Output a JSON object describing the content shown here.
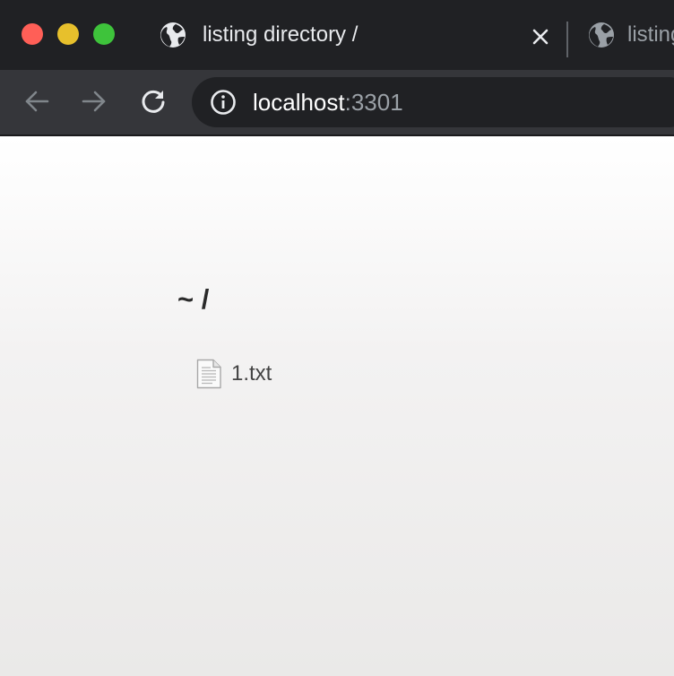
{
  "window": {
    "controls": [
      "close",
      "minimize",
      "maximize"
    ]
  },
  "tabs": [
    {
      "title": "listing directory /",
      "active": true,
      "icon": "globe-icon"
    },
    {
      "title": "listing directory /",
      "active": false,
      "icon": "globe-icon"
    }
  ],
  "toolbar": {
    "back_icon": "back-arrow-icon",
    "forward_icon": "forward-arrow-icon",
    "reload_icon": "reload-icon",
    "address": {
      "info_icon": "info-icon",
      "host": "localhost",
      "port": ":3301"
    }
  },
  "page": {
    "heading": "~ /",
    "files": [
      {
        "name": "1.txt",
        "icon": "text-file-icon"
      }
    ]
  },
  "colors": {
    "titlebar": "#202124",
    "toolbar": "#35363a",
    "close": "#ff5f57",
    "minimize": "#e7c02c",
    "maximize": "#3ec33b"
  }
}
